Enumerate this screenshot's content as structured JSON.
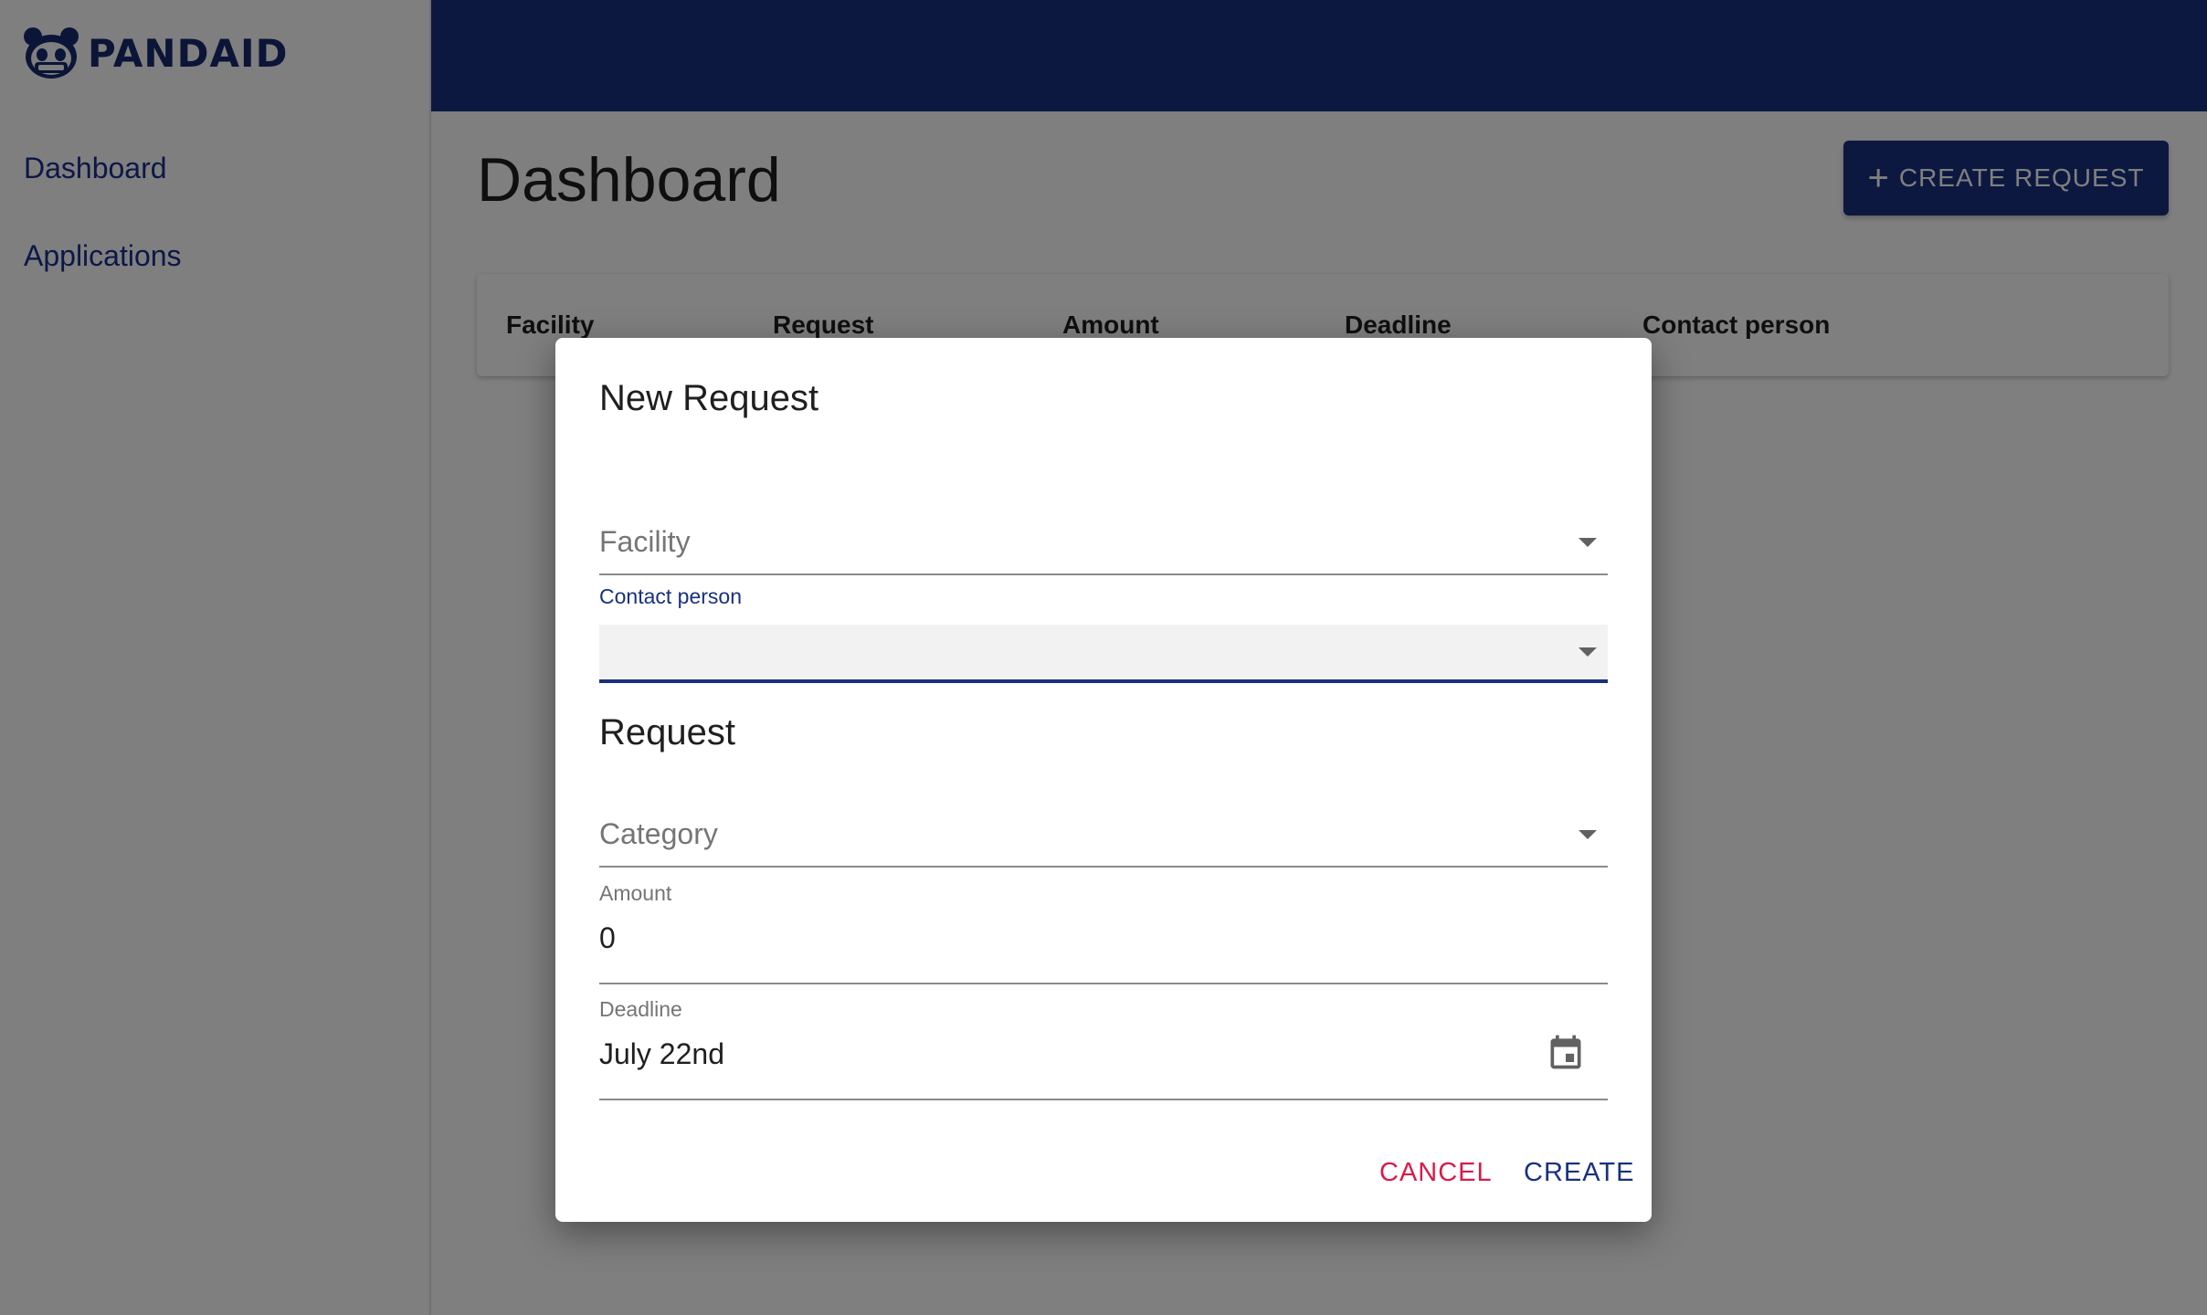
{
  "app": {
    "logo_text": "PANDAID",
    "brand_color": "#18317f"
  },
  "sidebar": {
    "items": [
      {
        "label": "Dashboard"
      },
      {
        "label": "Applications"
      }
    ]
  },
  "main": {
    "title": "Dashboard",
    "create_request_label": "CREATE REQUEST",
    "table": {
      "columns": [
        "Facility",
        "Request",
        "Amount",
        "Deadline",
        "Contact person"
      ]
    }
  },
  "dialog": {
    "title": "New Request",
    "facility": {
      "placeholder": "Facility"
    },
    "contact_person": {
      "label": "Contact person",
      "value": ""
    },
    "request_section_title": "Request",
    "category": {
      "placeholder": "Category"
    },
    "amount": {
      "label": "Amount",
      "value": "0"
    },
    "deadline": {
      "label": "Deadline",
      "value": "July 22nd",
      "icon": "calendar-icon"
    },
    "cancel_label": "CANCEL",
    "create_label": "CREATE",
    "colors": {
      "cancel": "#d81b4b",
      "create": "#18317f"
    }
  }
}
